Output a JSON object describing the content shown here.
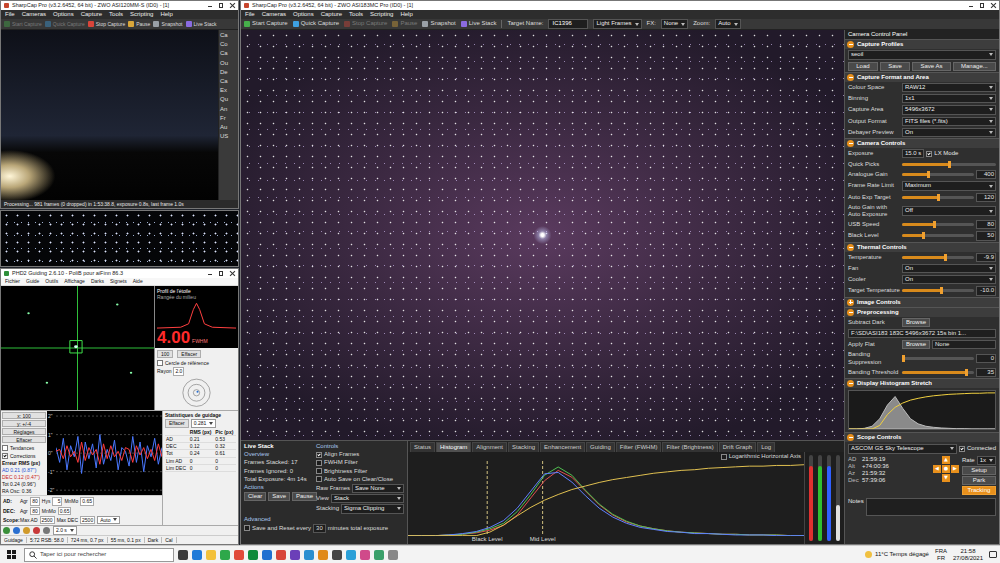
{
  "allsky": {
    "title": "SharpCap Pro (v3.2.6452, 64 bit) - ZWO ASI120MM-S (ID0) - [1]",
    "menu": [
      "File",
      "Cameras",
      "Options",
      "Capture",
      "Tools",
      "Scripting",
      "Help"
    ],
    "toolbar": [
      {
        "label": "Start Capture",
        "disabled": true
      },
      {
        "label": "Quick Capture",
        "disabled": true
      },
      {
        "label": "Stop Capture",
        "disabled": false
      },
      {
        "label": "Pause",
        "disabled": false
      },
      {
        "label": "Snapshot",
        "disabled": false
      },
      {
        "label": "Live Stack",
        "disabled": false
      }
    ],
    "side_tabs": [
      "Ca",
      "Co",
      "Ca",
      "Ou",
      "De",
      "Ca",
      "Ex",
      "Qu",
      "An",
      "Fr",
      "Au",
      "US"
    ],
    "status": "Processing... 981 frames (0 dropped) in 1:53:38.8, exposure 0.8s, last frame 1.0s"
  },
  "phd": {
    "title": "PHD2 Guiding 2.6.10 - PoliB pour aiFinn 86.3",
    "menu": [
      "Fichier",
      "Guide",
      "Outils",
      "Affichage",
      "Darks",
      "Signets",
      "Aide"
    ],
    "profile": {
      "title": "Profil de l'étoile",
      "caption": "Rangée du milieu",
      "value": "4.00",
      "unit": "FWHM"
    },
    "target": {
      "buttons": [
        "100",
        "Effacer"
      ],
      "check": {
        "label": "Cercle de référence",
        "checked": false
      },
      "radius_label": "Rayon",
      "radius": "2.0"
    },
    "graph": {
      "buttons": [
        "x: 100",
        "y: +/-4",
        "Réglages",
        "Effacer"
      ],
      "checks": [
        {
          "label": "Tendances",
          "checked": false
        },
        {
          "label": "Corrections",
          "checked": true
        }
      ],
      "rms_title": "Erreur RMS (px)",
      "rms": [
        "AD 0.21 (0.87\")",
        "DEC 0.12 (0.47\")",
        "Tot 0.24 (0.96\")"
      ],
      "osc": "RA Osc: 0.36",
      "ticks": [
        "2\"",
        "1\"",
        "0\"",
        "-1\"",
        "-2\""
      ],
      "range": [
        2,
        -2
      ],
      "series": [
        {
          "color": "#4a78ff",
          "values": [
            0.3,
            -0.5,
            0.8,
            -0.9,
            0.4,
            -0.2,
            0.9,
            -1.1,
            0.6,
            -0.3,
            0.5,
            -0.8,
            1.0,
            -0.6,
            0.2,
            -0.4,
            0.7,
            -0.9,
            0.3,
            0.1,
            -0.7,
            0.9,
            -0.5,
            0.6,
            -1.0,
            0.4,
            -0.2,
            0.8,
            -0.6,
            0.3
          ]
        },
        {
          "color": "#ff3b3b",
          "values": [
            0.1,
            0.2,
            -0.3,
            0.4,
            -0.2,
            0.1,
            -0.5,
            0.6,
            -0.4,
            0.3,
            -0.1,
            0.2,
            -0.6,
            0.5,
            -0.3,
            0.4,
            -0.2,
            0.1,
            -0.4,
            0.3,
            0.2,
            -0.5,
            0.4,
            -0.1,
            0.3,
            -0.3,
            0.2,
            -0.4,
            0.5,
            -0.2
          ]
        }
      ]
    },
    "stats": {
      "title": "Statistiques de guidage",
      "button": "Effacer",
      "value": "0.281",
      "columns": [
        "RMS (px)",
        "Pic (px)"
      ],
      "rows": [
        {
          "label": "AD",
          "values": [
            "0.21",
            "0.53"
          ]
        },
        {
          "label": "DEC",
          "values": [
            "0.12",
            "0.32"
          ]
        },
        {
          "label": "Tot",
          "values": [
            "0.24",
            "0.61"
          ]
        },
        {
          "label": "Lim AD",
          "values": [
            "0",
            "0"
          ]
        },
        {
          "label": "Lim DEC",
          "values": [
            "0",
            "0"
          ]
        }
      ]
    },
    "controls": [
      {
        "label": "AD:",
        "fields": [
          {
            "label": "Agr",
            "value": "80"
          },
          {
            "label": "Hys",
            "value": "5"
          },
          {
            "label": "MnMo",
            "value": "0.65"
          }
        ]
      },
      {
        "label": "DEC:",
        "fields": [
          {
            "label": "Agr",
            "value": "80"
          },
          {
            "label": "MnMo",
            "value": "0.65"
          }
        ]
      },
      {
        "label": "Scope:",
        "fields": [
          {
            "label": "Max AD",
            "value": "2500"
          },
          {
            "label": "Max DEC",
            "value": "2500"
          }
        ],
        "mode": "Auto"
      }
    ],
    "exposure": "2.0 s",
    "status": [
      "Guidage",
      "5:72 RSB: 58.0",
      "724 ms, 0.7 px",
      "55 ms, 0.1 px",
      "Dark",
      "Cal"
    ]
  },
  "main": {
    "title": "SharpCap Pro (v3.2.6452, 64 bit) - ZWO ASI183MC Pro (ID0) - [1]",
    "menu": [
      "File",
      "Cameras",
      "Options",
      "Capture",
      "Tools",
      "Scripting",
      "Help"
    ],
    "toolbar": [
      {
        "label": "Start Capture",
        "disabled": false
      },
      {
        "label": "Quick Capture",
        "disabled": false
      },
      {
        "label": "Stop Capture",
        "disabled": true
      },
      {
        "label": "Pause",
        "disabled": true
      },
      {
        "label": "Snapshot",
        "disabled": false
      },
      {
        "label": "Live Stack",
        "disabled": false
      }
    ],
    "target_label": "Target Name:",
    "target": "IC1396",
    "frame_type": "Light Frames",
    "fx_label": "FX:",
    "fx": "None",
    "zoom_label": "Zoom:",
    "zoom": "Auto",
    "livestack": {
      "title": "Live Stack",
      "overview": {
        "title": "Overview",
        "rows": [
          "Frames Stacked: 17",
          "Frames Ignored: 0",
          "Total Exposure: 4m 14s"
        ]
      },
      "actions": {
        "title": "Actions",
        "buttons": [
          "Clear",
          "Save",
          "Pause"
        ]
      },
      "advanced": {
        "title": "Advanced",
        "checked": false,
        "before": "Save and Reset every",
        "value": "30",
        "after": "minutes total exposure"
      },
      "controls": {
        "title": "Controls",
        "checks": [
          {
            "label": "Align Frames",
            "checked": true
          },
          {
            "label": "FWHM Filter",
            "checked": false
          },
          {
            "label": "Brightness Filter",
            "checked": false
          },
          {
            "label": "Auto Save on Clear/Close",
            "checked": false
          }
        ],
        "selects": [
          {
            "label": "Raw Frames",
            "value": "Save None"
          },
          {
            "label": "View",
            "value": "Stack"
          },
          {
            "label": "Stacking",
            "value": "Sigma Clipping"
          }
        ]
      },
      "tabs": [
        {
          "label": "Status",
          "selected": false
        },
        {
          "label": "Histogram",
          "selected": true
        },
        {
          "label": "Alignment",
          "selected": false
        },
        {
          "label": "Stacking",
          "selected": false
        },
        {
          "label": "Enhancement",
          "selected": false
        },
        {
          "label": "Guiding",
          "selected": false
        },
        {
          "label": "Filter (FWHM)",
          "selected": false
        },
        {
          "label": "Filter (Brightness)",
          "selected": false
        },
        {
          "label": "Drift Graph",
          "selected": false
        },
        {
          "label": "Log",
          "selected": false
        }
      ],
      "histogram": {
        "log_label": "Logarithmic Horizontal Axis",
        "log_checked": false,
        "markers": [
          {
            "label": "Black Level",
            "x": 0.2
          },
          {
            "label": "Mid Level",
            "x": 0.34
          }
        ],
        "series": [
          {
            "color": "#e05050",
            "values": [
              0,
              0,
              0,
              1,
              2,
              4,
              8,
              15,
              30,
              55,
              80,
              95,
              85,
              65,
              45,
              30,
              20,
              14,
              10,
              7,
              5,
              4,
              3,
              2,
              2,
              1,
              1,
              1,
              0,
              0
            ]
          },
          {
            "color": "#50c050",
            "values": [
              0,
              0,
              0,
              1,
              2,
              5,
              10,
              18,
              35,
              60,
              88,
              100,
              88,
              66,
              46,
              31,
              21,
              14,
              10,
              7,
              5,
              4,
              3,
              2,
              2,
              1,
              1,
              1,
              0,
              0
            ]
          },
          {
            "color": "#6080ff",
            "values": [
              0,
              0,
              0,
              1,
              3,
              6,
              12,
              22,
              40,
              65,
              90,
              92,
              78,
              58,
              40,
              27,
              18,
              12,
              9,
              6,
              5,
              3,
              3,
              2,
              1,
              1,
              1,
              0,
              0,
              0
            ]
          }
        ],
        "transfer": [
          0,
          0,
          0,
          0,
          0,
          0,
          5,
          15,
          28,
          40,
          50,
          58,
          65,
          70,
          75,
          79,
          82,
          85,
          88,
          90,
          92,
          93,
          95,
          96,
          97,
          98,
          98,
          99,
          99,
          100
        ],
        "sliders": [
          {
            "color": "#e03030",
            "level": 0.88
          },
          {
            "color": "#30c030",
            "level": 0.88
          },
          {
            "color": "#3060ff",
            "level": 0.88
          },
          {
            "color": "#e0e0e0",
            "level": 0.42
          }
        ]
      }
    },
    "panel": {
      "title": "Camera Control Panel",
      "sections": [
        {
          "title": "Capture Profiles",
          "expanded": true,
          "rows": [
            {
              "kind": "select",
              "label": "",
              "value": "seoil"
            },
            {
              "kind": "buttons",
              "items": [
                "Load",
                "Save",
                "Save As",
                "Manage..."
              ]
            }
          ]
        },
        {
          "title": "Capture Format and Area",
          "expanded": true,
          "rows": [
            {
              "kind": "select",
              "label": "Colour Space",
              "value": "RAW12"
            },
            {
              "kind": "select",
              "label": "Binning",
              "value": "1x1"
            },
            {
              "kind": "select",
              "label": "Capture Area",
              "value": "5496x3672"
            },
            {
              "kind": "select",
              "label": "Output Format",
              "value": "FITS files (*.fits)"
            },
            {
              "kind": "select",
              "label": "Debayer Preview",
              "value": "On"
            }
          ]
        },
        {
          "title": "Camera Controls",
          "expanded": true,
          "rows": [
            {
              "kind": "input",
              "label": "Exposure",
              "value": "15.0 s",
              "check": {
                "label": "LX Mode",
                "checked": true
              }
            },
            {
              "kind": "slider",
              "label": "Quick Picks",
              "level": 0.5
            },
            {
              "kind": "slider",
              "label": "Analogue Gain",
              "level": 0.37,
              "value": "400"
            },
            {
              "kind": "select",
              "label": "Frame Rate Limit",
              "value": "Maximum"
            },
            {
              "kind": "slider",
              "label": "Auto Exp Target",
              "level": 0.5,
              "value": "120"
            },
            {
              "kind": "select",
              "label": "Auto Gain with Auto Exposure",
              "value": "Off"
            },
            {
              "kind": "slider",
              "label": "USB Speed",
              "level": 0.45,
              "value": "80"
            },
            {
              "kind": "slider",
              "label": "Black Level",
              "level": 0.3,
              "value": "50"
            }
          ]
        },
        {
          "title": "Thermal Controls",
          "expanded": true,
          "rows": [
            {
              "kind": "slider",
              "label": "Temperature",
              "level": 0.6,
              "value": "-9.9"
            },
            {
              "kind": "select",
              "label": "Fan",
              "value": "On"
            },
            {
              "kind": "select",
              "label": "Cooler",
              "value": "On"
            },
            {
              "kind": "slider",
              "label": "Target Temperature",
              "level": 0.55,
              "value": "-10.0"
            }
          ]
        },
        {
          "title": "Image Controls",
          "expanded": false,
          "rows": []
        },
        {
          "title": "Preprocessing",
          "expanded": true,
          "rows": [
            {
              "kind": "browse",
              "label": "Subtract Dark",
              "button": "Browse",
              "value": "F:\\SD\\ASI183 183C 5496x3672 15s bin 1..."
            },
            {
              "kind": "browse",
              "label": "Apply Flat",
              "button": "Browse",
              "value": "None"
            },
            {
              "kind": "slider",
              "label": "Banding Suppression",
              "level": 0.02,
              "value": "0"
            },
            {
              "kind": "slider",
              "label": "Banding Threshold",
              "level": 0.9,
              "value": "35"
            }
          ]
        },
        {
          "title": "Display Histogram Stretch",
          "expanded": true,
          "rows": [
            {
              "kind": "chart",
              "values": [
                0,
                0,
                2,
                8,
                30,
                70,
                95,
                60,
                30,
                15,
                8,
                5,
                3,
                2,
                1,
                1,
                0,
                0,
                0,
                0
              ],
              "curve": [
                0,
                0,
                0,
                0,
                10,
                40,
                60,
                72,
                80,
                85,
                89,
                92,
                94,
                96,
                97,
                98,
                99,
                99,
                100,
                100
              ]
            }
          ]
        },
        {
          "title": "Scope Controls",
          "expanded": true,
          "rows": [
            {
              "kind": "scope",
              "device": "ASCOM GS Sky Telescope",
              "connected_label": "Connected",
              "connected": true,
              "readouts": [
                {
                  "label": "AD",
                  "value": "21:59:19"
                },
                {
                  "label": "Alt",
                  "value": "+74:00:36"
                },
                {
                  "label": "Az",
                  "value": "21:59:32"
                },
                {
                  "label": "Dec",
                  "value": "57:39:06"
                }
              ],
              "pad": [
                "▲",
                "◀",
                "●",
                "▶",
                "▼"
              ],
              "rate_label": "Rate",
              "rate": "1x",
              "buttons": [
                {
                  "label": "Setup",
                  "on": false
                },
                {
                  "label": "Park",
                  "on": false
                },
                {
                  "label": "Tracking",
                  "on": true
                }
              ]
            },
            {
              "kind": "notes",
              "label": "Notes"
            }
          ]
        }
      ]
    }
  },
  "taskbar": {
    "search": "Taper ici pour rechercher",
    "apps": [
      {
        "color": "#3c3c3c"
      },
      {
        "color": "#1f7ad8"
      },
      {
        "color": "#f3c13a"
      },
      {
        "color": "#2ea84a"
      },
      {
        "color": "#e04a3a"
      },
      {
        "color": "#0f8a3a"
      },
      {
        "color": "#1f6fd0"
      },
      {
        "color": "#d8453a"
      },
      {
        "color": "#6b3fb8"
      },
      {
        "color": "#2a8fd0"
      },
      {
        "color": "#e08a1a"
      },
      {
        "color": "#444444"
      },
      {
        "color": "#2aa0d8"
      },
      {
        "color": "#d04a8a"
      },
      {
        "color": "#3aa06a"
      },
      {
        "color": "#888888"
      }
    ],
    "weather": "11°C  Temps dégagé",
    "lang": [
      "FRA",
      "FR"
    ],
    "time": "21:58",
    "date": "27/08/2021"
  }
}
